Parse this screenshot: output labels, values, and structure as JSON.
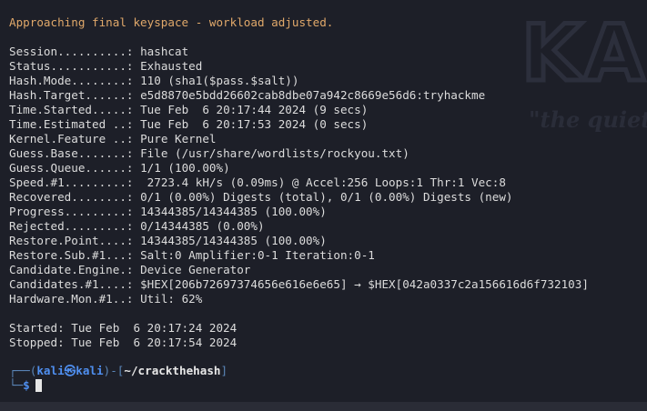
{
  "terminal": {
    "warning": "Approaching final keyspace - workload adjusted.",
    "status_lines": [
      {
        "key": "Session..........:",
        "value": "hashcat"
      },
      {
        "key": "Status...........:",
        "value": "Exhausted"
      },
      {
        "key": "Hash.Mode........:",
        "value": "110 (sha1($pass.$salt))"
      },
      {
        "key": "Hash.Target......:",
        "value": "e5d8870e5bdd26602cab8dbe07a942c8669e56d6:tryhackme"
      },
      {
        "key": "Time.Started.....:",
        "value": "Tue Feb  6 20:17:44 2024 (9 secs)"
      },
      {
        "key": "Time.Estimated ..:",
        "value": "Tue Feb  6 20:17:53 2024 (0 secs)"
      },
      {
        "key": "Kernel.Feature ..:",
        "value": "Pure Kernel"
      },
      {
        "key": "Guess.Base.......:",
        "value": "File (/usr/share/wordlists/rockyou.txt)"
      },
      {
        "key": "Guess.Queue......:",
        "value": "1/1 (100.00%)"
      },
      {
        "key": "Speed.#1.........:",
        "value": " 2723.4 kH/s (0.09ms) @ Accel:256 Loops:1 Thr:1 Vec:8"
      },
      {
        "key": "Recovered........:",
        "value": "0/1 (0.00%) Digests (total), 0/1 (0.00%) Digests (new)"
      },
      {
        "key": "Progress.........:",
        "value": "14344385/14344385 (100.00%)"
      },
      {
        "key": "Rejected.........:",
        "value": "0/14344385 (0.00%)"
      },
      {
        "key": "Restore.Point....:",
        "value": "14344385/14344385 (100.00%)"
      },
      {
        "key": "Restore.Sub.#1...:",
        "value": "Salt:0 Amplifier:0-1 Iteration:0-1"
      },
      {
        "key": "Candidate.Engine.:",
        "value": "Device Generator"
      },
      {
        "key": "Candidates.#1....:",
        "value": "$HEX[206b72697374656e616e6e65] → $HEX[042a0337c2a156616d6f732103]"
      },
      {
        "key": "Hardware.Mon.#1..:",
        "value": "Util: 62%"
      }
    ],
    "started": "Started: Tue Feb  6 20:17:24 2024",
    "stopped": "Stopped: Tue Feb  6 20:17:54 2024"
  },
  "prompt": {
    "frame_top_left": "┌──(",
    "user_host": "kali㉿kali",
    "frame_mid": ")-[",
    "cwd": "~/crackthehash",
    "frame_end": "]",
    "frame_bottom": "└─",
    "symbol": "$"
  },
  "watermark": {
    "logo_text": "KA",
    "tagline": "\"the quieter"
  },
  "colors": {
    "background": "#1d1f28",
    "warning": "#e0a86a",
    "prompt_accent": "#4f8ff0",
    "text": "#dcdcdc"
  }
}
